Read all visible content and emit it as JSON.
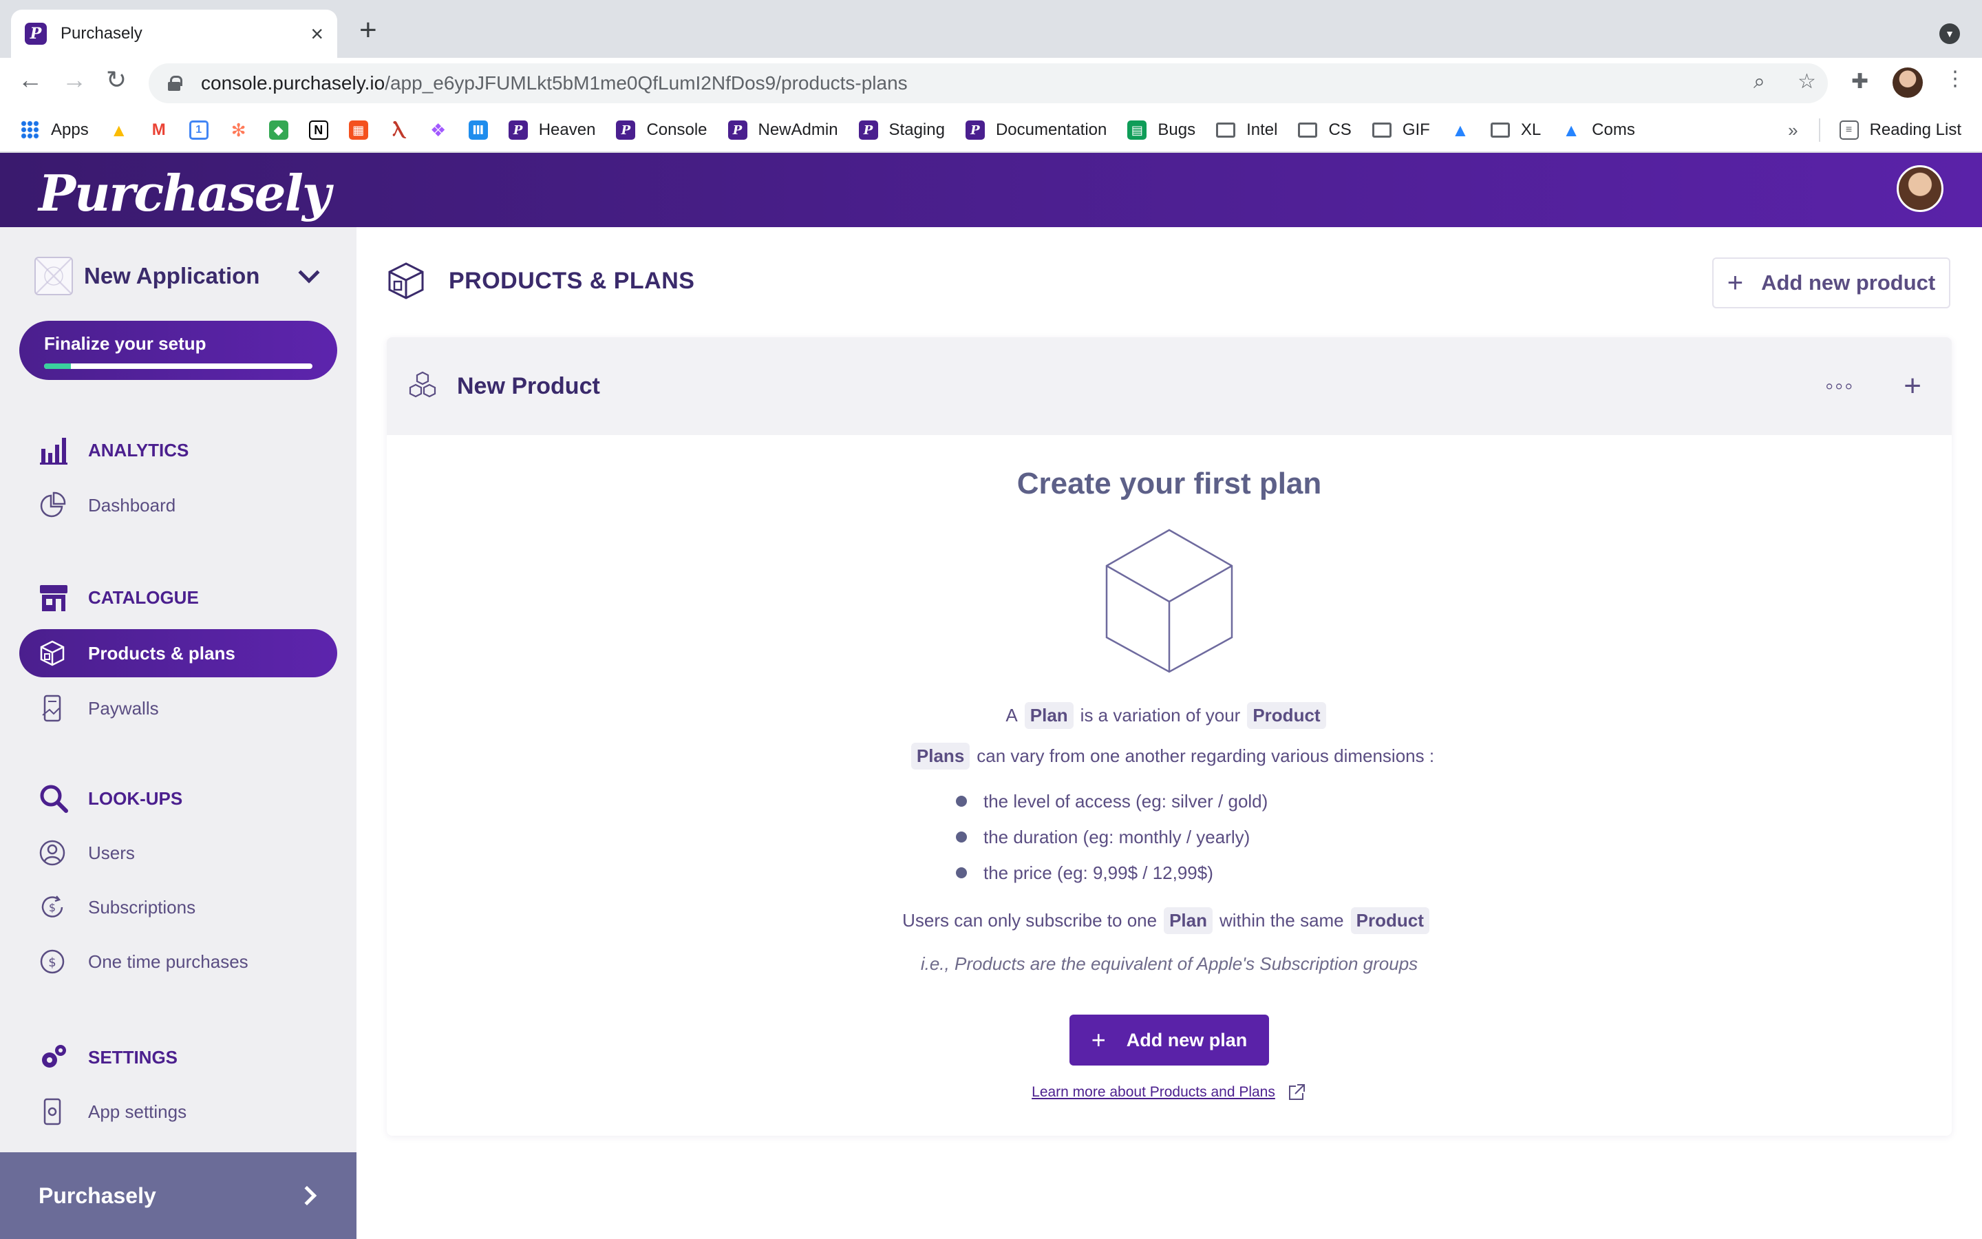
{
  "browser": {
    "tab_title": "Purchasely",
    "tab_favicon_letter": "P",
    "url_host": "console.purchasely.io",
    "url_path": "/app_e6ypJFUMLkt5bM1me0QfLumI2NfDos9/products-plans",
    "bookmarks": [
      {
        "label": "Apps",
        "icon": "apps-grid-icon"
      },
      {
        "label": "",
        "icon": "google-drive-icon"
      },
      {
        "label": "",
        "icon": "gmail-icon"
      },
      {
        "label": "",
        "icon": "google-calendar-icon"
      },
      {
        "label": "",
        "icon": "hubspot-icon"
      },
      {
        "label": "",
        "icon": "google-maps-icon"
      },
      {
        "label": "",
        "icon": "notion-icon"
      },
      {
        "label": "",
        "icon": "calendar-app-icon"
      },
      {
        "label": "",
        "icon": "stick-figure-icon"
      },
      {
        "label": "",
        "icon": "figma-icon"
      },
      {
        "label": "",
        "icon": "intercom-icon"
      },
      {
        "label": "Heaven",
        "icon": "purchasely-icon"
      },
      {
        "label": "Console",
        "icon": "purchasely-icon"
      },
      {
        "label": "NewAdmin",
        "icon": "purchasely-icon"
      },
      {
        "label": "Staging",
        "icon": "purchasely-icon"
      },
      {
        "label": "Documentation",
        "icon": "purchasely-icon"
      },
      {
        "label": "Bugs",
        "icon": "google-sheets-icon"
      },
      {
        "label": "Intel",
        "icon": "folder-icon"
      },
      {
        "label": "CS",
        "icon": "folder-icon"
      },
      {
        "label": "GIF",
        "icon": "folder-icon"
      },
      {
        "label": "",
        "icon": "atlassian-icon"
      },
      {
        "label": "XL",
        "icon": "folder-icon"
      },
      {
        "label": "Coms",
        "icon": "atlassian-icon"
      }
    ],
    "bookmarks_more": "»",
    "reading_list": "Reading List"
  },
  "header": {
    "logo_text": "Purchasely"
  },
  "sidebar": {
    "app_name": "New Application",
    "setup_label": "Finalize your setup",
    "setup_progress": 0.1,
    "sections": {
      "analytics": "ANALYTICS",
      "catalogue": "CATALOGUE",
      "lookups": "LOOK-UPS",
      "settings": "SETTINGS"
    },
    "items": {
      "dashboard": "Dashboard",
      "products_plans": "Products & plans",
      "paywalls": "Paywalls",
      "users": "Users",
      "subscriptions": "Subscriptions",
      "one_time_purchases": "One time purchases",
      "app_settings": "App settings"
    },
    "footer_label": "Purchasely"
  },
  "main": {
    "page_title": "PRODUCTS & PLANS",
    "add_product_label": "Add new product",
    "add_product_plus": "+",
    "product_name": "New Product",
    "more_menu": "◦◦◦",
    "add_plan_plus": "+",
    "empty": {
      "title": "Create your first plan",
      "line1_a": "A",
      "line1_chip_plan": "Plan",
      "line1_b": "is a variation of your",
      "line1_chip_product": "Product",
      "line2_chip_plans": "Plans",
      "line2_text": "can vary from one another regarding various dimensions :",
      "bullets": [
        "the level of access (eg: silver / gold)",
        "the duration (eg: monthly / yearly)",
        "the price (eg: 9,99$ / 12,99$)"
      ],
      "line3_a": "Users can only subscribe to one",
      "line3_chip_plan": "Plan",
      "line3_b": "within the same",
      "line3_chip_product": "Product",
      "note": "i.e., Products are the equivalent of Apple's Subscription groups",
      "add_plan_label": "Add new plan",
      "add_plan_plus": "+",
      "learn_more": "Learn more about Products and Plans"
    }
  },
  "colors": {
    "brand_purple": "#4b1f8e",
    "sidebar_bg": "#efeff2",
    "progress_green": "#3ad09e"
  }
}
